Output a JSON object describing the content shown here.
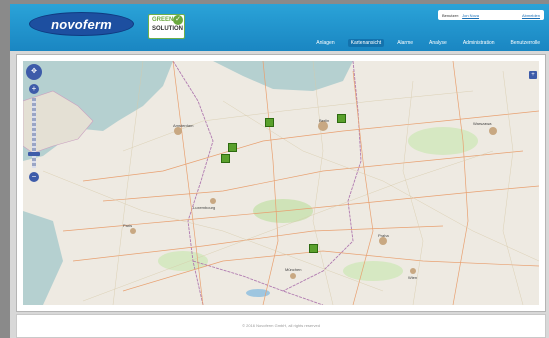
{
  "header": {
    "logo_text": "novoferm",
    "badge_line1": "GREEN",
    "badge_line2": "SOLUTION",
    "badge_check": "✓"
  },
  "userbar": {
    "user_label": "Benutzer:",
    "user_name": "Jon Nova",
    "logout": "Abmelden"
  },
  "nav": [
    {
      "label": "Anlagen"
    },
    {
      "label": "Kartenansicht",
      "active": true
    },
    {
      "label": "Alarme"
    },
    {
      "label": "Analyse"
    },
    {
      "label": "Administration"
    },
    {
      "label": "Benutzerrolle"
    }
  ],
  "map": {
    "labels": [
      {
        "text": "Amsterdam"
      },
      {
        "text": "Berlin"
      },
      {
        "text": "Warszawa"
      },
      {
        "text": "Luxembourg"
      },
      {
        "text": "Paris"
      },
      {
        "text": "Praha"
      },
      {
        "text": "Wien"
      },
      {
        "text": "München"
      }
    ],
    "marker_count": 5
  },
  "footer": {
    "text": "© 2016 Novoferm GmbH, all rights reserved"
  }
}
